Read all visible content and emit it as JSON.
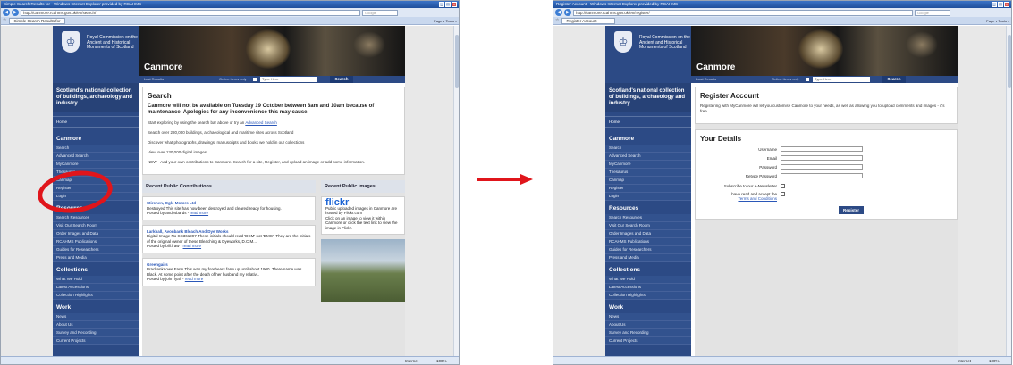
{
  "left": {
    "window_title": "Simple Search Results for - Windows Internet Explorer provided by RCAHMS",
    "url": "http://canmore.rcahms.gov.uk/en/search/",
    "search_placeholder": "Google",
    "tab_label": "Simple Search Results for",
    "tools": "Page ▾  Tools ▾",
    "status_zone": "Internet",
    "status_zoom": "100%",
    "site": {
      "logo_text": "Royal Commission on the Ancient and Historical Monuments of Scotland",
      "brand": "Canmore",
      "search_strip": {
        "last_results": "Last Results",
        "online_only": "Online items only",
        "placeholder": "Type Here",
        "button": "Search"
      },
      "tagline": "Scotland's national collection of buildings, archaeology and industry",
      "home": "Home",
      "sections": [
        {
          "title": "Canmore",
          "items": [
            "Search",
            "Advanced Search",
            "MyCanmore",
            "Thesaurus",
            "Canmap",
            "Register",
            "Login"
          ]
        },
        {
          "title": "Resources",
          "items": [
            "Search Resources",
            "Visit Our Search Room",
            "Order Images and Data",
            "RCAHMS Publications",
            "Guides for Researchers",
            "Press and Media"
          ]
        },
        {
          "title": "Collections",
          "items": [
            "What We Hold",
            "Latest Accessions",
            "Collection Highlights"
          ]
        },
        {
          "title": "Work",
          "items": [
            "News",
            "About Us",
            "Survey and Recording",
            "Current Projects"
          ]
        }
      ],
      "search_card": {
        "title": "Search",
        "notice": "Canmore will not be available on Tuesday 19 October between 8am and 10am because of maintenance. Apologies for any inconvenience this may cause.",
        "p1": "Start exploring by using the search bar above or try an",
        "p1_link": "Advanced Search",
        "p2": "Search over 280,000 buildings, archaeological and maritime sites across Scotland",
        "p3": "Discover what photographs, drawings, manuscripts and books we hold in our collections",
        "p4": "View over 130,000 digital images",
        "p5": "NEW - Add your own contributions to Canmore. Search for a site, Register, and upload an image or add some information."
      },
      "contributions_title": "Recent Public Contributions",
      "contributions": [
        {
          "title": "Stirchen, Ogle Motors Ltd",
          "body": "Destroyed This site has now been destroyed and cleared ready for housing.",
          "by": "Posted by andysbards -",
          "more": "read more"
        },
        {
          "title": "Larkhall, Avonbank Bleach And Dye Works",
          "body": "Digital Image No SC361997 These initials should read 'DCM' not 'DMC'. They are the initials of the original owner of these Bleaching & Dyeworks, D.C.M...",
          "by": "Posted by bill.fraw -",
          "more": "read more"
        },
        {
          "title": "Greengairs",
          "body": "Brackenknowe Farm This was my forebears farm up until about 1900. There name was Black. At some point after the death of her husband my relativ...",
          "by": "Posted by john lyall -",
          "more": "read more"
        }
      ],
      "images_title": "Recent Public Images",
      "flickr": "flickr",
      "images_text1": "Public uploaded images in Canmore are hosted by Flickr.com",
      "images_text2": "Click on an image to view it within Canmore or click the text link to view the image in Flickr."
    }
  },
  "right": {
    "window_title": "Register Account - Windows Internet Explorer provided by RCAHMS",
    "url": "http://canmore.rcahms.gov.uk/en/register/",
    "search_placeholder": "Google",
    "tab_label": "Register Account",
    "tools": "Page ▾  Tools ▾",
    "status_zone": "Internet",
    "status_zoom": "100%",
    "site": {
      "logo_text": "Royal Commission on the Ancient and Historical Monuments of Scotland",
      "brand": "Canmore",
      "search_strip": {
        "last_results": "Last Results",
        "online_only": "Online items only",
        "placeholder": "Type Here",
        "button": "Search"
      },
      "tagline": "Scotland's national collection of buildings, archaeology and industry",
      "home": "Home",
      "sections": [
        {
          "title": "Canmore",
          "items": [
            "Search",
            "Advanced Search",
            "MyCanmore",
            "Thesaurus",
            "Canmap",
            "Register",
            "Login"
          ]
        },
        {
          "title": "Resources",
          "items": [
            "Search Resources",
            "Visit Our Search Room",
            "Order Images and Data",
            "RCAHMS Publications",
            "Guides for Researchers",
            "Press and Media"
          ]
        },
        {
          "title": "Collections",
          "items": [
            "What We Hold",
            "Latest Accessions",
            "Collection Highlights"
          ]
        },
        {
          "title": "Work",
          "items": [
            "News",
            "About Us",
            "Survey and Recording",
            "Current Projects"
          ]
        }
      ],
      "register_card": {
        "title": "Register Account",
        "intro": "Registering with MyCanmore will let you customise Canmore to your needs, as well as allowing you to upload comments and images - it's free."
      },
      "details_card": {
        "title": "Your Details",
        "fields": [
          "Username",
          "Email",
          "Password",
          "Retype Password"
        ],
        "newsletter": "Subscribe to our e-Newsletter",
        "terms_prefix": "I have read and accept the",
        "terms_link": "Terms and Conditions",
        "button": "Register"
      }
    }
  }
}
